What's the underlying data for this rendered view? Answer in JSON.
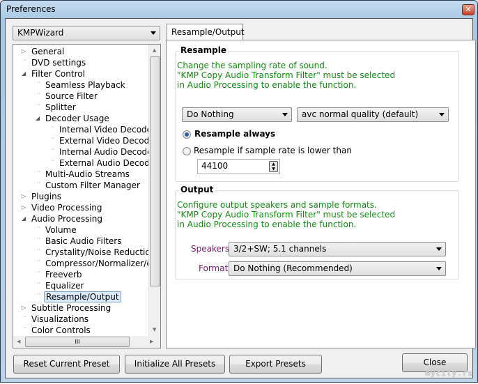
{
  "window": {
    "title": "Preferences",
    "close_icon": "close-icon"
  },
  "preset": {
    "selected": "KMPWizard"
  },
  "tree": {
    "items": [
      {
        "label": "General",
        "level": 0,
        "expander": "collapsed"
      },
      {
        "label": "DVD settings",
        "level": 0,
        "expander": "none"
      },
      {
        "label": "Filter Control",
        "level": 0,
        "expander": "expanded"
      },
      {
        "label": "Seamless Playback",
        "level": 1,
        "expander": "none"
      },
      {
        "label": "Source Filter",
        "level": 1,
        "expander": "none"
      },
      {
        "label": "Splitter",
        "level": 1,
        "expander": "none"
      },
      {
        "label": "Decoder Usage",
        "level": 1,
        "expander": "expanded"
      },
      {
        "label": "Internal Video Decoder",
        "level": 2,
        "expander": "none"
      },
      {
        "label": "External Video Decoder",
        "level": 2,
        "expander": "none"
      },
      {
        "label": "Internal Audio Decoder",
        "level": 2,
        "expander": "none"
      },
      {
        "label": "External Audio Decoder",
        "level": 2,
        "expander": "none"
      },
      {
        "label": "Multi-Audio Streams",
        "level": 1,
        "expander": "none"
      },
      {
        "label": "Custom Filter Manager",
        "level": 1,
        "expander": "none"
      },
      {
        "label": "Plugins",
        "level": 0,
        "expander": "collapsed"
      },
      {
        "label": "Video Processing",
        "level": 0,
        "expander": "collapsed"
      },
      {
        "label": "Audio Processing",
        "level": 0,
        "expander": "expanded"
      },
      {
        "label": "Volume",
        "level": 1,
        "expander": "none"
      },
      {
        "label": "Basic Audio Filters",
        "level": 1,
        "expander": "none"
      },
      {
        "label": "Crystality/Noise Reduction",
        "level": 1,
        "expander": "none"
      },
      {
        "label": "Compressor/Normalizer/etc",
        "level": 1,
        "expander": "none"
      },
      {
        "label": "Freeverb",
        "level": 1,
        "expander": "none"
      },
      {
        "label": "Equalizer",
        "level": 1,
        "expander": "none"
      },
      {
        "label": "Resample/Output",
        "level": 1,
        "expander": "none",
        "selected": true
      },
      {
        "label": "Subtitle Processing",
        "level": 0,
        "expander": "collapsed"
      },
      {
        "label": "Visualizations",
        "level": 0,
        "expander": "none"
      },
      {
        "label": "Color Controls",
        "level": 0,
        "expander": "none"
      }
    ],
    "hscroll_grip": "III"
  },
  "tab": {
    "label": "Resample/Output"
  },
  "resample": {
    "title": "Resample",
    "description": "Change the sampling rate of sound.\n\"KMP Copy Audio Transform Filter\" must be selected\nin Audio Processing to enable the function.",
    "mode": "Do Nothing",
    "quality": "avc normal quality (default)",
    "radio_always": "Resample always",
    "radio_lower": "Resample if sample rate is lower than",
    "selected_radio": "always",
    "rate": "44100"
  },
  "output": {
    "title": "Output",
    "description": "Configure output speakers and sample formats.\n\"KMP Copy Audio Transform Filter\" must be selected\nin Audio Processing to enable the function.",
    "speakers_label": "Speakers:",
    "speakers_value": "3/2+SW; 5.1 channels",
    "format_label": "Format:",
    "format_value": "Do Nothing (Recommended)"
  },
  "buttons": {
    "reset": "Reset Current Preset",
    "initialize": "Initialize All Presets",
    "export": "Export Presets",
    "close": "Close"
  },
  "watermark": "mycity.rs",
  "colors": {
    "hint_text": "#138a13",
    "label_text": "#7a1a6e",
    "selection": "#dcebfc"
  }
}
